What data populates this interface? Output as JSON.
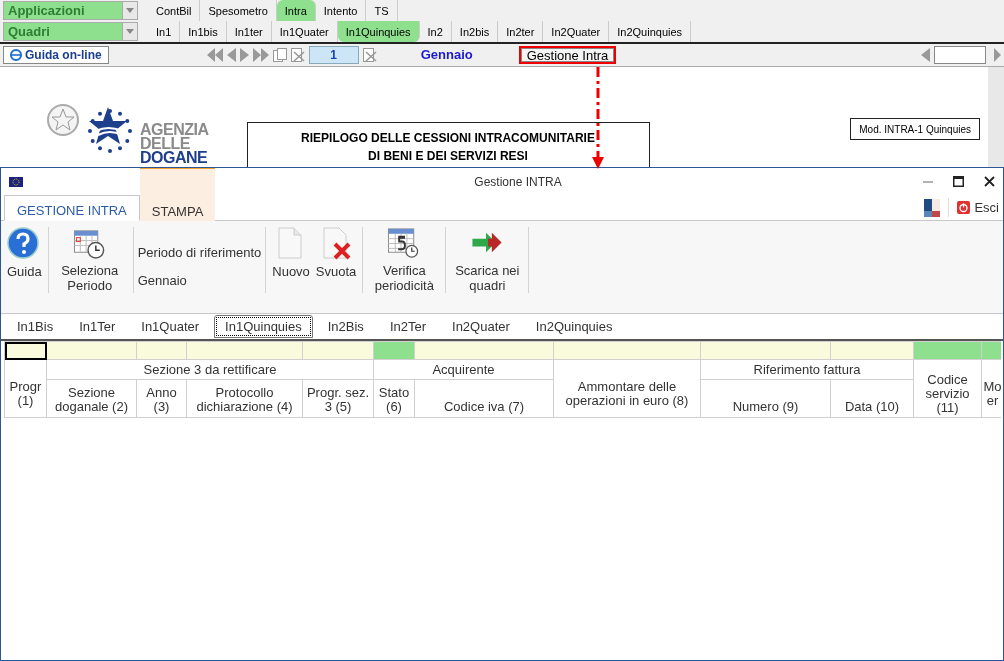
{
  "applications_field": {
    "value": "Applicazioni"
  },
  "quadri_field": {
    "value": "Quadri"
  },
  "app_tabs": [
    {
      "label": "ContBil",
      "selected": false
    },
    {
      "label": "Spesometro",
      "selected": false
    },
    {
      "label": "Intra",
      "selected": true
    },
    {
      "label": "Intento",
      "selected": false
    },
    {
      "label": "TS",
      "selected": false
    }
  ],
  "quadri_tabs": [
    {
      "label": "In1",
      "selected": false
    },
    {
      "label": "In1bis",
      "selected": false
    },
    {
      "label": "In1ter",
      "selected": false
    },
    {
      "label": "In1Quater",
      "selected": false
    },
    {
      "label": "In1Quinquies",
      "selected": true
    },
    {
      "label": "In2",
      "selected": false
    },
    {
      "label": "In2bis",
      "selected": false
    },
    {
      "label": "In2ter",
      "selected": false
    },
    {
      "label": "In2Quater",
      "selected": false
    },
    {
      "label": "In2Quinquies",
      "selected": false
    }
  ],
  "toolbar": {
    "help_link": "Guida on-line",
    "page": "1",
    "month": "Gennaio",
    "action_button": {
      "label": "Gestione Intra",
      "highlighted": true
    }
  },
  "document": {
    "logo_text": [
      "AGENZIA",
      "DELLE",
      "DOGANE"
    ],
    "title_lines": [
      "RIEPILOGO DELLE CESSIONI INTRACOMUNITARIE",
      "DI BENI E DEI SERVIZI RESI"
    ],
    "model_label": "Mod. INTRA-1 Quinquies"
  },
  "dialog": {
    "title": "Gestione INTRA",
    "ribbon_tabs": [
      {
        "label": "GESTIONE INTRA",
        "selected": true,
        "highlighted": false
      },
      {
        "label": "STAMPA",
        "selected": false,
        "highlighted": true
      }
    ],
    "exit_button": "Esci",
    "ribbon_groups": [
      {
        "items": [
          {
            "kind": "help",
            "label": "Guida"
          }
        ]
      },
      {
        "items": [
          {
            "kind": "schedule",
            "label": "Seleziona Periodo"
          },
          {
            "kind": "info",
            "label": "Periodo di riferimento",
            "value": "Gennaio"
          }
        ]
      },
      {
        "items": [
          {
            "kind": "new",
            "label": "Nuovo"
          },
          {
            "kind": "clear",
            "label": "Svuota"
          }
        ]
      },
      {
        "items": [
          {
            "kind": "verify",
            "label": "Verifica periodicità"
          }
        ]
      },
      {
        "items": [
          {
            "kind": "export",
            "label": "Scarica nei quadri"
          }
        ]
      }
    ],
    "sheet_tabs": [
      {
        "label": "In1Bis",
        "selected": false
      },
      {
        "label": "In1Ter",
        "selected": false
      },
      {
        "label": "In1Quater",
        "selected": false
      },
      {
        "label": "In1Quinquies",
        "selected": true
      },
      {
        "label": "In2Bis",
        "selected": false
      },
      {
        "label": "In2Ter",
        "selected": false
      },
      {
        "label": "In2Quater",
        "selected": false
      },
      {
        "label": "In2Quinquies",
        "selected": false
      }
    ],
    "table": {
      "header": [
        {
          "label": "Progr (1)",
          "highlighted": false,
          "selected": true
        },
        {
          "group": "Sezione 3 da rettificare",
          "columns": [
            {
              "label": "Sezione doganale (2)",
              "highlighted": false,
              "selected": false
            },
            {
              "label": "Anno (3)",
              "highlighted": false,
              "selected": false
            },
            {
              "label": "Protocollo dichiarazione (4)",
              "highlighted": false,
              "selected": false
            },
            {
              "label": "Progr. sez. 3 (5)",
              "highlighted": false,
              "selected": false
            }
          ]
        },
        {
          "group": "Acquirente",
          "columns": [
            {
              "label": "Stato (6)",
              "highlighted": true,
              "selected": false
            },
            {
              "label": "Codice iva (7)",
              "highlighted": false,
              "selected": false
            }
          ]
        },
        {
          "label": "Ammontare delle operazioni in euro (8)",
          "highlighted": false,
          "selected": false
        },
        {
          "group": "Riferimento fattura",
          "columns": [
            {
              "label": "Numero (9)",
              "highlighted": false,
              "selected": false
            },
            {
              "label": "Data (10)",
              "highlighted": false,
              "selected": false
            }
          ]
        },
        {
          "label": "Codice servizio (11)",
          "highlighted": true,
          "selected": false
        },
        {
          "label": "Mo er",
          "highlighted": true,
          "selected": false
        }
      ]
    }
  }
}
